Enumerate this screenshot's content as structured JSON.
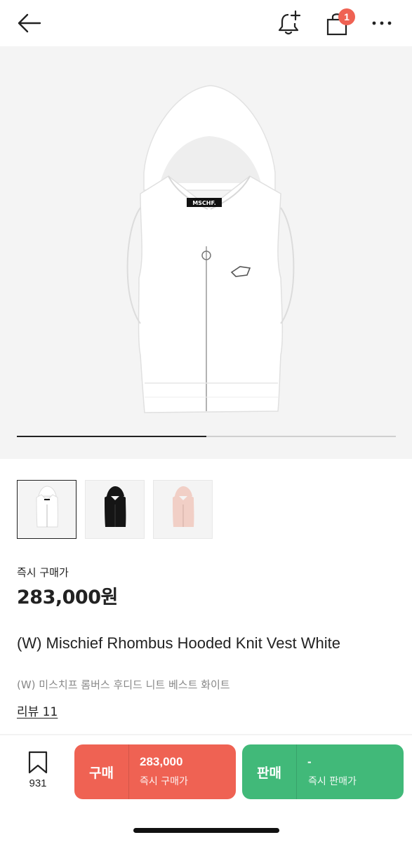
{
  "header": {
    "icons": [
      "back-arrow-icon",
      "bell-plus-icon",
      "shopping-bag-icon",
      "more-icon"
    ],
    "cart_badge": "1",
    "badge_color": "#ef6253"
  },
  "hero": {
    "image_desc_icon": "hooded-vest-image",
    "logo_text": "MSCHF.",
    "progress": 0.5
  },
  "thumbnails": [
    {
      "name": "white",
      "selected": true
    },
    {
      "name": "black",
      "selected": false
    },
    {
      "name": "pink",
      "selected": false
    }
  ],
  "product": {
    "price_label": "즉시 구매가",
    "price": "283,000원",
    "title": "(W) Mischief Rhombus Hooded Knit Vest White",
    "subtitle": "(W) 미스치프 롬버스 후디드 니트 베스트 화이트",
    "review_link": "리뷰 11"
  },
  "bottom_bar": {
    "wishlist_count": "931",
    "buy": {
      "label": "구매",
      "price": "283,000",
      "sub": "즉시 구매가",
      "color": "#ef6253"
    },
    "sell": {
      "label": "판매",
      "price": "-",
      "sub": "즉시 판매가",
      "color": "#41b979"
    }
  }
}
